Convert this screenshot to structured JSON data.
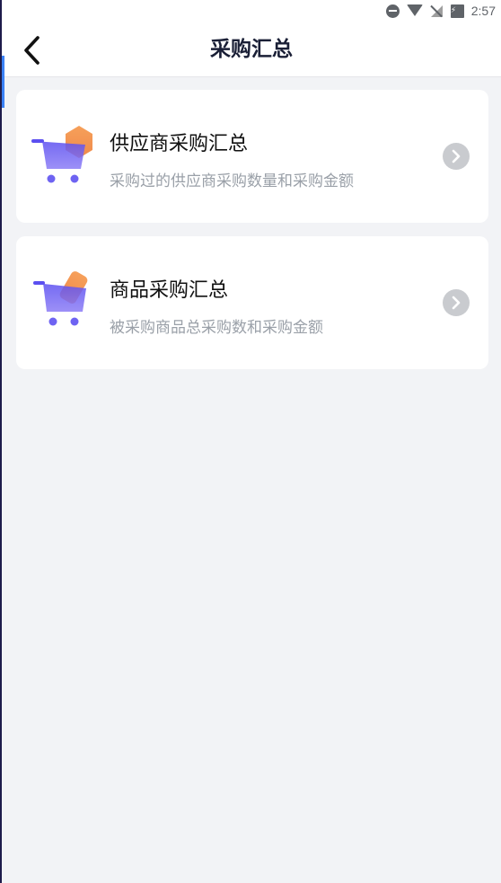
{
  "status_bar": {
    "time": "2:57"
  },
  "header": {
    "title": "采购汇总"
  },
  "items": [
    {
      "title": "供应商采购汇总",
      "description": "采购过的供应商采购数量和采购金额",
      "icon": "cart-hexagon-icon"
    },
    {
      "title": "商品采购汇总",
      "description": "被采购商品总采购数和采购金额",
      "icon": "cart-tag-icon"
    }
  ],
  "colors": {
    "accent_orange": "#f6a05a",
    "accent_purple": "#5b4ff0",
    "background": "#f2f3f6"
  }
}
